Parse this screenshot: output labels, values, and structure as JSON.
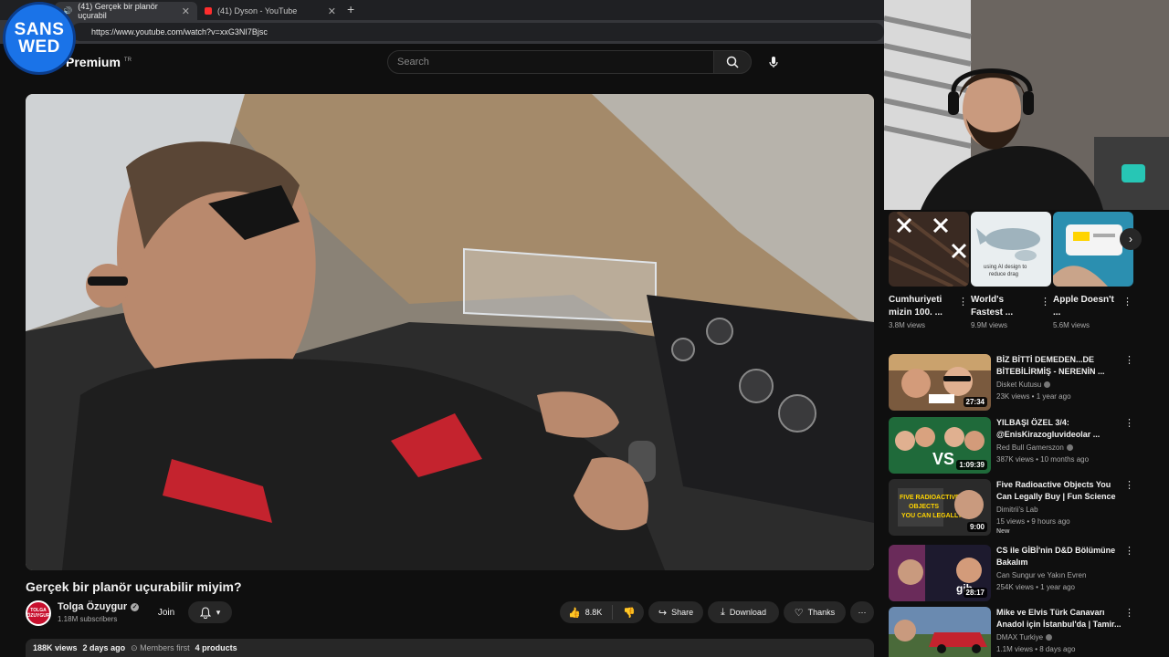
{
  "browser": {
    "tabs": [
      {
        "label": "(41) Gerçek bir planör uçurabil"
      },
      {
        "label": "(41) Dyson - YouTube"
      }
    ],
    "url": "https://www.youtube.com/watch?v=xxG3NI7Bjsc"
  },
  "logo": {
    "line1": "SANS",
    "line2": "WED"
  },
  "header": {
    "brand": "Premium",
    "brand_suffix": "TR",
    "search_placeholder": "Search"
  },
  "video": {
    "title": "Gerçek bir planör uçurabilir miyim?",
    "channel": "Tolga Özuygur",
    "subscribers": "1.18M subscribers",
    "avatar_text": "TOLGA ÖZUYGUR",
    "join_label": "Join",
    "likes": "8.8K",
    "share_label": "Share",
    "download_label": "Download",
    "thanks_label": "Thanks",
    "views": "188K views",
    "posted": "2 days ago",
    "members": "Members first",
    "products": "4 products"
  },
  "shorts": [
    {
      "title": "Cumhuriyeti mizin 100. ...",
      "views": "3.8M views"
    },
    {
      "title": "World's Fastest ...",
      "views": "9.9M views"
    },
    {
      "title": "Apple Doesn't ...",
      "views": "5.6M views"
    }
  ],
  "recommendations": [
    {
      "title": "BİZ BİTTİ DEMEDEN...DE BİTEBİLİRMİŞ - NERENİN ...",
      "channel": "Disket Kutusu",
      "verified": true,
      "meta": "23K views • 1 year ago",
      "duration": "27:34",
      "badge": ""
    },
    {
      "title": "YILBAŞI ÖZEL 3/4: @EnisKirazogluvideolar ...",
      "channel": "Red Bull Gamerszon",
      "verified": true,
      "meta": "387K views • 10 months ago",
      "duration": "1:09:39",
      "badge": ""
    },
    {
      "title": "Five Radioactive Objects You Can Legally Buy | Fun Science",
      "channel": "Dimitrii's Lab",
      "verified": false,
      "meta": "15 views • 9 hours ago",
      "duration": "9:00",
      "badge": "New"
    },
    {
      "title": "CS ile GİBİ'nin D&D Bölümüne Bakalım",
      "channel": "Can Sungur ve Yakın Evren",
      "verified": false,
      "meta": "254K views • 1 year ago",
      "duration": "28:17",
      "badge": ""
    },
    {
      "title": "Mike ve Elvis Türk Canavarı Anadol için İstanbul'da | Tamir...",
      "channel": "DMAX Turkiye",
      "verified": true,
      "meta": "1.1M views • 8 days ago",
      "duration": "",
      "badge": ""
    }
  ],
  "colors": {
    "accent": "#1a73e8",
    "brand_red": "#ff0000",
    "background": "#0f0f0f"
  }
}
